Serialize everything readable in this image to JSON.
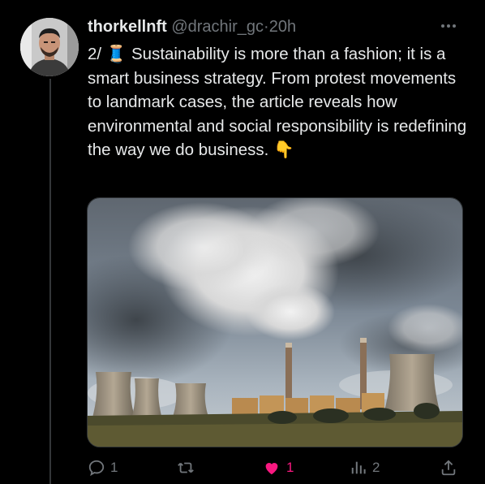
{
  "tweet": {
    "display_name": "thorkellnft",
    "handle": "@drachir_gc",
    "separator": "·",
    "time": "20h",
    "text": "2/ 🧵 Sustainability is more than a fashion; it is a smart business strategy. From protest movements to landmark cases, the article reveals how environmental and social responsibility is redefining the way we do business. 👇"
  },
  "actions": {
    "reply_count": "1",
    "retweet_count": "",
    "like_count": "1",
    "views_count": "2"
  },
  "icons": {
    "more": "more-icon",
    "reply": "reply-icon",
    "retweet": "retweet-icon",
    "like": "heart-icon",
    "views": "views-icon",
    "share": "share-icon"
  },
  "colors": {
    "background": "#000000",
    "text": "#e7e9ea",
    "muted": "#71767b",
    "like": "#f91880"
  }
}
